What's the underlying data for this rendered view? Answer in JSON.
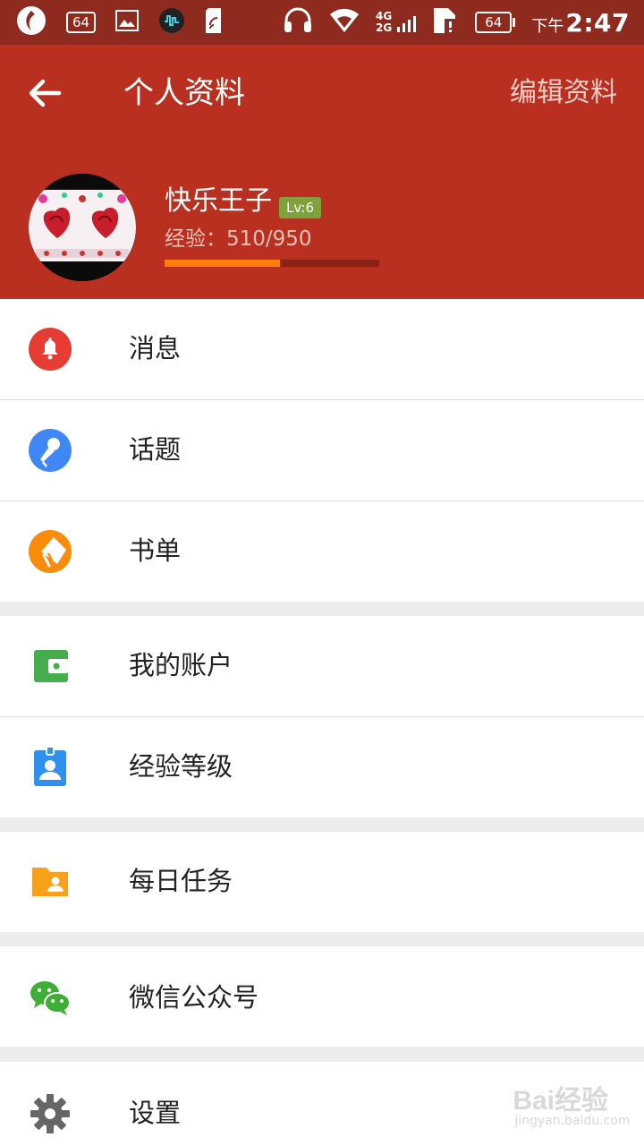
{
  "status_bar": {
    "notif_badge": "64",
    "battery_level": "64",
    "net_top": "4G",
    "net_bottom": "2G",
    "time_prefix": "下午",
    "time": "2:47"
  },
  "header": {
    "title": "个人资料",
    "edit_label": "编辑资料",
    "username": "快乐王子",
    "level": "Lv:6",
    "exp_label": "经验：",
    "exp_current": 510,
    "exp_max": 950,
    "exp_text": "510/950"
  },
  "menu": {
    "messages": "消息",
    "topics": "话题",
    "booklist": "书单",
    "account": "我的账户",
    "exp_level": "经验等级",
    "daily_tasks": "每日任务",
    "wechat": "微信公众号",
    "settings": "设置"
  },
  "colors": {
    "header_bg": "#b93020",
    "status_bg": "#8f2a1f",
    "exp_fill": "#ff7d0a",
    "level_badge": "#7fa23d",
    "icon_messages": "#e53c33",
    "icon_topics": "#3f87f5",
    "icon_booklist": "#fb8c0b",
    "icon_account": "#46ad4e",
    "icon_exp_level": "#2f90ef",
    "icon_tasks": "#f7a01a",
    "icon_wechat": "#3fae35",
    "icon_settings": "#666666"
  },
  "watermark": {
    "logo": "Bai经验",
    "url": "jingyan.baidu.com"
  }
}
